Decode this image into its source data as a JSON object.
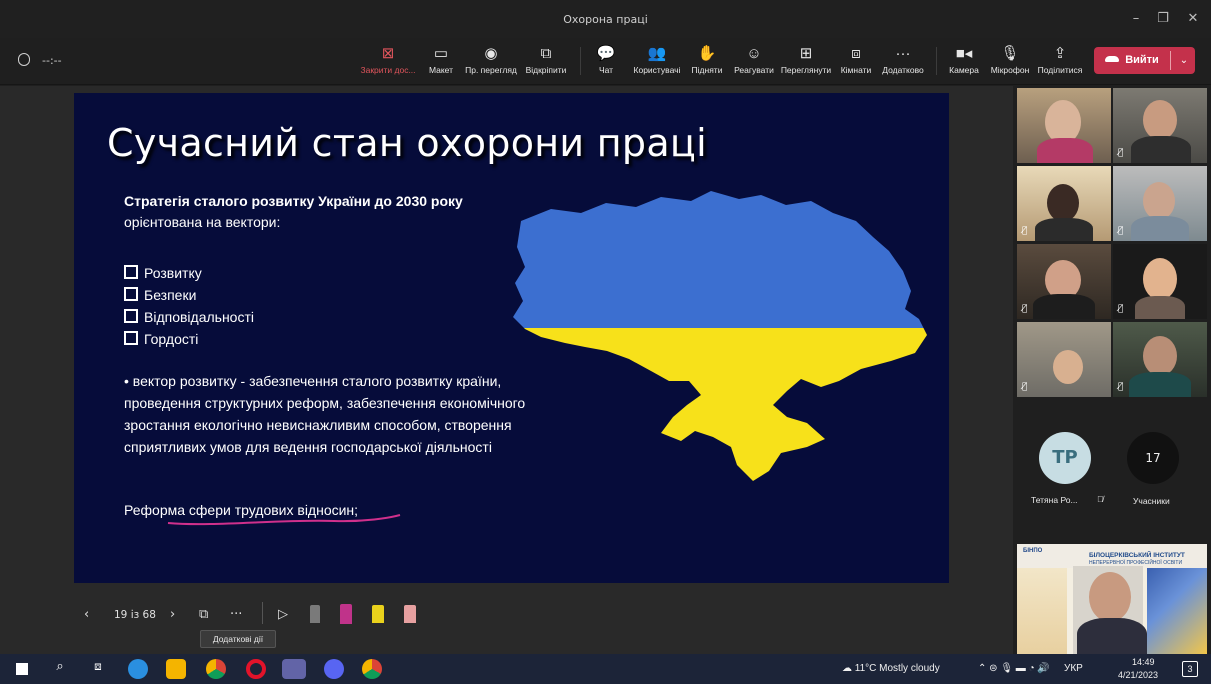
{
  "window": {
    "title": "Охорона праці"
  },
  "timer": "--:--",
  "toolbar": {
    "items": [
      {
        "label": "Закрити дос...",
        "icon": "close-share-icon"
      },
      {
        "label": "Макет",
        "icon": "layout-icon"
      },
      {
        "label": "Пр. перегляд",
        "icon": "preview-icon"
      },
      {
        "label": "Відкріпити",
        "icon": "popout-icon"
      },
      {
        "label": "Чат",
        "icon": "chat-icon"
      },
      {
        "label": "Користувачі",
        "icon": "people-icon"
      },
      {
        "label": "Підняти",
        "icon": "raise-hand-icon"
      },
      {
        "label": "Реагувати",
        "icon": "react-icon"
      },
      {
        "label": "Переглянути",
        "icon": "view-icon"
      },
      {
        "label": "Кімнати",
        "icon": "rooms-icon"
      },
      {
        "label": "Додатково",
        "icon": "more-icon"
      },
      {
        "label": "Камера",
        "icon": "camera-icon"
      },
      {
        "label": "Мікрофон",
        "icon": "mic-icon"
      },
      {
        "label": "Поділитися",
        "icon": "share-icon"
      }
    ],
    "leave_label": "Вийти"
  },
  "slide": {
    "title": "Сучасний стан охорони праці",
    "strategy": "Стратегія сталого розвитку України до 2030 року",
    "oriented": "орієнтована на вектори:",
    "vectors": [
      "Розвитку",
      "Безпеки",
      "Відповідальності",
      "Гордості"
    ],
    "paragraph": "• вектор розвитку - забезпечення сталого розвитку країни, проведення структурних реформ, забезпечення економічного зростання екологічно невиснажливим способом, створення сприятливих умов для ведення господарської діяльності",
    "reform": "Реформа сфери трудових відносин;",
    "map_colors": {
      "blue": "#3c6fd0",
      "yellow": "#f7e11a"
    }
  },
  "slide_controls": {
    "page": "19 із 68",
    "tooltip": "Додаткові дії"
  },
  "participants": {
    "initials": "ТР",
    "name": "Тетяна Ро...",
    "count": "17",
    "count_label": "Учасники"
  },
  "presenter_banner": {
    "logo": "БІНПО",
    "line1": "БІЛОЦЕРКІВСЬКИЙ ІНСТИТУТ",
    "line2": "НЕПЕРЕРВНОЇ ПРОФЕСІЙНОЇ ОСВІТИ"
  },
  "taskbar": {
    "weather": "11°C  Mostly cloudy",
    "lang": "УКР",
    "time": "14:49",
    "date": "4/21/2023",
    "notif_count": "3"
  }
}
